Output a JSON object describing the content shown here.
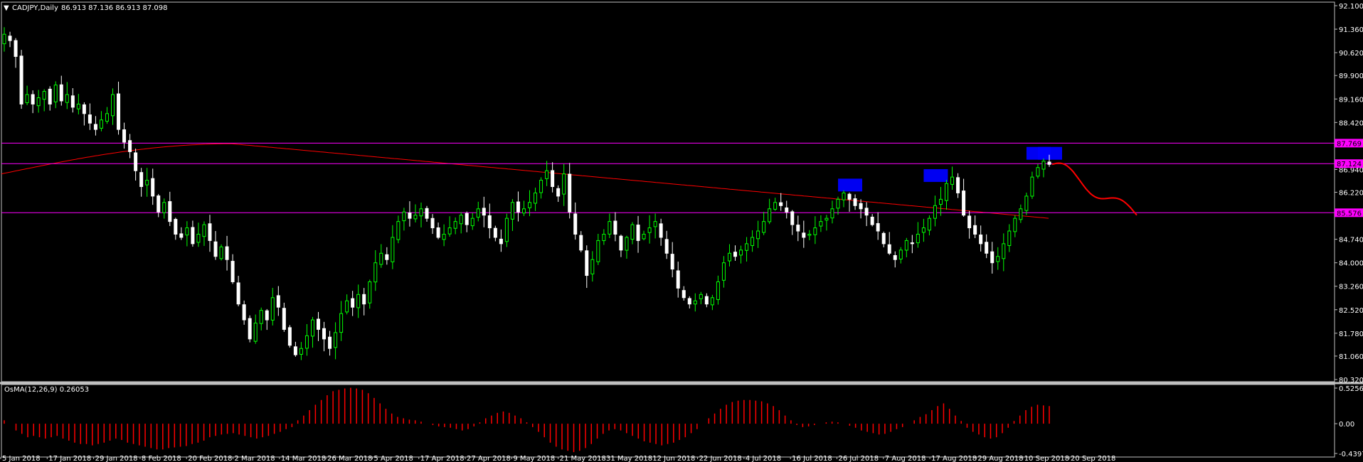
{
  "header": {
    "symbol_label": "CADJPY,Daily",
    "ohlc_label": "86.913 87.136 86.913 87.098",
    "indicator_label": "OsMA(12,26,9) 0.26053"
  },
  "colors": {
    "background": "#000000",
    "frame": "#c0c0c0",
    "bull": "#00ff00",
    "bear": "#ffffff",
    "moving_average": "#ff0000",
    "level_lines": "#ff00ff",
    "projection": "#ff0000",
    "highlight_boxes": "#0000ff",
    "osma_bars": "#ff0000"
  },
  "chart_data": [
    {
      "type": "candlestick",
      "title": "CADJPY,Daily",
      "ylim": [
        80.32,
        92.1
      ],
      "price_axis_ticks": [
        "92.100",
        "91.360",
        "90.620",
        "89.900",
        "89.160",
        "88.420",
        "86.940",
        "86.220",
        "84.740",
        "84.000",
        "83.260",
        "82.520",
        "81.780",
        "81.060",
        "80.320"
      ],
      "price_axis_highlight_tags": [
        "87.769",
        "87.124",
        "85.576"
      ],
      "horizontal_levels": [
        87.769,
        87.124,
        85.576
      ],
      "date_axis_labels": [
        "5 Jan 2018",
        "17 Jan 2018",
        "29 Jan 2018",
        "8 Feb 2018",
        "20 Feb 2018",
        "2 Mar 2018",
        "14 Mar 2018",
        "26 Mar 2018",
        "5 Apr 2018",
        "17 Apr 2018",
        "27 Apr 2018",
        "9 May 2018",
        "21 May 2018",
        "31 May 2018",
        "12 Jun 2018",
        "22 Jun 2018",
        "4 Jul 2018",
        "16 Jul 2018",
        "26 Jul 2018",
        "7 Aug 2018",
        "17 Aug 2018",
        "29 Aug 2018",
        "10 Sep 2018",
        "20 Sep 2018"
      ],
      "close_series": [
        91.2,
        91.0,
        90.5,
        89.0,
        89.3,
        89.0,
        89.2,
        89.4,
        89.0,
        89.6,
        89.1,
        89.3,
        88.9,
        89.0,
        88.7,
        88.4,
        88.2,
        88.5,
        88.7,
        89.3,
        88.2,
        87.8,
        87.5,
        86.9,
        86.4,
        86.6,
        86.1,
        85.6,
        85.9,
        85.3,
        84.9,
        84.8,
        85.1,
        84.6,
        84.9,
        85.2,
        84.7,
        84.2,
        84.5,
        84.1,
        83.4,
        82.7,
        82.2,
        81.6,
        82.1,
        82.5,
        82.2,
        82.9,
        82.6,
        81.9,
        81.4,
        81.1,
        81.3,
        81.7,
        82.2,
        81.9,
        81.6,
        81.3,
        81.8,
        82.4,
        82.8,
        82.6,
        83.0,
        82.7,
        83.4,
        84.0,
        84.3,
        84.1,
        84.8,
        85.3,
        85.6,
        85.4,
        85.5,
        85.7,
        85.4,
        85.1,
        84.8,
        84.9,
        85.1,
        85.3,
        85.5,
        85.2,
        85.4,
        85.7,
        85.5,
        85.1,
        84.8,
        84.6,
        85.4,
        85.9,
        85.6,
        85.7,
        85.9,
        86.2,
        86.6,
        86.9,
        86.4,
        86.1,
        86.8,
        85.6,
        84.9,
        84.4,
        83.6,
        84.1,
        84.7,
        84.9,
        85.3,
        84.9,
        84.4,
        84.8,
        85.2,
        84.7,
        84.9,
        85.1,
        85.3,
        84.8,
        84.3,
        83.8,
        83.2,
        82.9,
        82.7,
        82.8,
        83.0,
        82.7,
        82.9,
        83.4,
        84.0,
        84.3,
        84.2,
        84.4,
        84.6,
        84.8,
        85.0,
        85.3,
        85.7,
        85.9,
        85.8,
        85.6,
        85.2,
        85.0,
        84.8,
        84.9,
        85.1,
        85.3,
        85.4,
        85.7,
        86.0,
        86.2,
        86.0,
        85.8,
        85.7,
        85.5,
        85.2,
        85.0,
        84.6,
        84.3,
        84.1,
        84.4,
        84.7,
        84.6,
        84.9,
        85.1,
        85.4,
        85.8,
        86.0,
        86.5,
        86.7,
        86.2,
        85.5,
        85.1,
        84.9,
        84.6,
        84.3,
        84.0,
        84.2,
        84.6,
        85.0,
        85.4,
        85.7,
        86.1,
        86.7,
        87.0,
        87.2,
        87.1
      ],
      "moving_average": {
        "name": "",
        "start": 86.8,
        "peak": 87.75,
        "end": 85.4
      },
      "projection": {
        "from": 87.1,
        "to": 85.5
      },
      "highlight_boxes": 4
    },
    {
      "type": "bar",
      "title": "OsMA(12,26,9) 0.26053",
      "ylim": [
        -0.43971,
        0.52568
      ],
      "axis_ticks": [
        "0.52568",
        "0.00",
        "-0.43971"
      ],
      "values": [
        0.05,
        0.0,
        -0.1,
        -0.15,
        -0.2,
        -0.18,
        -0.2,
        -0.22,
        -0.2,
        -0.18,
        -0.22,
        -0.25,
        -0.28,
        -0.3,
        -0.3,
        -0.32,
        -0.3,
        -0.28,
        -0.25,
        -0.22,
        -0.24,
        -0.28,
        -0.3,
        -0.32,
        -0.34,
        -0.36,
        -0.38,
        -0.38,
        -0.36,
        -0.35,
        -0.34,
        -0.33,
        -0.3,
        -0.28,
        -0.25,
        -0.2,
        -0.18,
        -0.16,
        -0.15,
        -0.14,
        -0.16,
        -0.18,
        -0.2,
        -0.22,
        -0.2,
        -0.18,
        -0.15,
        -0.12,
        -0.08,
        -0.05,
        0.05,
        0.12,
        0.2,
        0.28,
        0.35,
        0.42,
        0.48,
        0.5,
        0.52,
        0.53,
        0.52,
        0.5,
        0.45,
        0.38,
        0.3,
        0.22,
        0.15,
        0.1,
        0.08,
        0.06,
        0.05,
        0.03,
        0.0,
        -0.02,
        -0.04,
        -0.05,
        -0.06,
        -0.08,
        -0.1,
        -0.08,
        -0.04,
        0.02,
        0.08,
        0.12,
        0.16,
        0.18,
        0.16,
        0.12,
        0.08,
        0.02,
        -0.05,
        -0.12,
        -0.2,
        -0.28,
        -0.34,
        -0.38,
        -0.4,
        -0.42,
        -0.4,
        -0.36,
        -0.3,
        -0.22,
        -0.15,
        -0.1,
        -0.08,
        -0.1,
        -0.14,
        -0.18,
        -0.22,
        -0.26,
        -0.28,
        -0.3,
        -0.32,
        -0.3,
        -0.28,
        -0.24,
        -0.2,
        -0.14,
        -0.08,
        0.0,
        0.08,
        0.15,
        0.22,
        0.28,
        0.32,
        0.34,
        0.35,
        0.35,
        0.34,
        0.33,
        0.3,
        0.26,
        0.2,
        0.12,
        0.05,
        -0.02,
        -0.05,
        -0.04,
        -0.02,
        0.0,
        0.02,
        0.03,
        0.02,
        0.0,
        -0.03,
        -0.06,
        -0.1,
        -0.12,
        -0.14,
        -0.16,
        -0.15,
        -0.12,
        -0.08,
        -0.05,
        0.0,
        0.05,
        0.1,
        0.14,
        0.2,
        0.26,
        0.3,
        0.22,
        0.12,
        0.04,
        -0.06,
        -0.12,
        -0.16,
        -0.2,
        -0.22,
        -0.2,
        -0.14,
        -0.06,
        0.04,
        0.12,
        0.2,
        0.25,
        0.28,
        0.27,
        0.26
      ]
    }
  ]
}
